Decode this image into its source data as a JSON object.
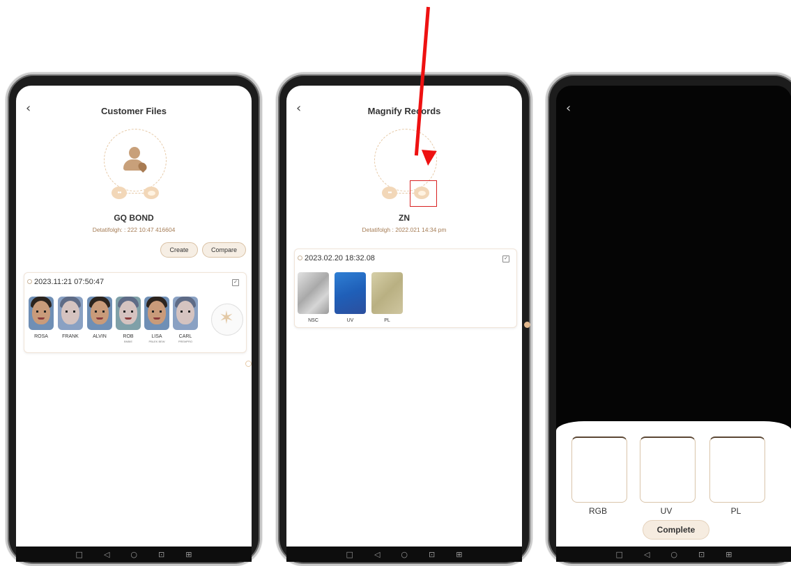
{
  "screen1": {
    "title": "Customer Files",
    "name": "GQ BOND",
    "detail": "Detatifolgh: : 222 10:47 416604",
    "create_label": "Create",
    "compare_label": "Compare",
    "record_date": "2023.11:21 07:50:47",
    "faces": [
      {
        "label": "ROSA",
        "sub": ""
      },
      {
        "label": "FRANK",
        "sub": ""
      },
      {
        "label": "ALVIN",
        "sub": ""
      },
      {
        "label": "ROB",
        "sub": "BNBIE"
      },
      {
        "label": "LISA",
        "sub": "PBLEK BEW"
      },
      {
        "label": "CARL",
        "sub": "PREMPRO"
      }
    ]
  },
  "screen2": {
    "title": "Magnify Records",
    "name": "ZN",
    "detail": "Detatifolgh : 2022.021 14:34 pm",
    "record_date": "2023.02.20 18:32.08",
    "thumbs": [
      {
        "label": "NSC"
      },
      {
        "label": "UV"
      },
      {
        "label": "PL"
      }
    ]
  },
  "screen3": {
    "slots": [
      {
        "label": "RGB"
      },
      {
        "label": "UV"
      },
      {
        "label": "PL"
      }
    ],
    "complete_label": "Complete"
  },
  "nav": {
    "recent": "□",
    "back": "◁",
    "home": "○",
    "square": "⊡",
    "extra": "⊞"
  },
  "colors": {
    "accent": "#c8a07a",
    "annotation": "#ee1111",
    "screen_dark": "#050505"
  },
  "icons": [
    "back-icon",
    "person-icon",
    "clock-icon",
    "check-icon",
    "radar-chart-icon"
  ]
}
